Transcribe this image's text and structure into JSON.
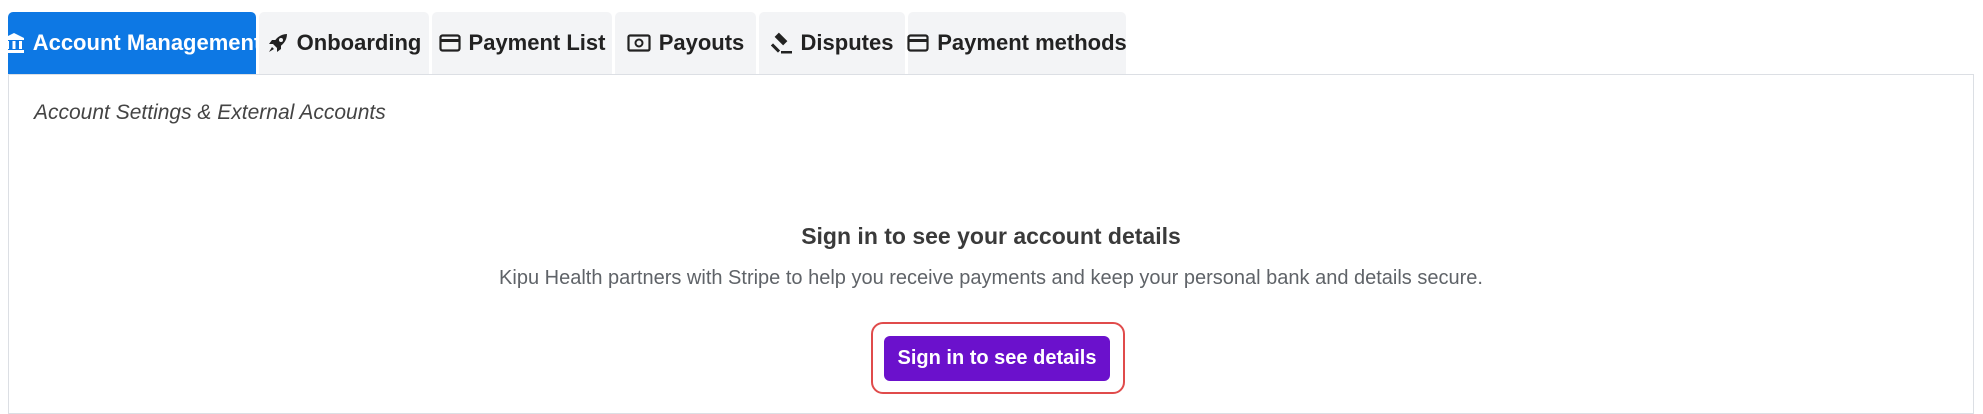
{
  "tabs": [
    {
      "label": "Account Management",
      "icon": "bank-icon",
      "active": true
    },
    {
      "label": "Onboarding",
      "icon": "rocket-icon",
      "active": false
    },
    {
      "label": "Payment List",
      "icon": "credit-card-icon",
      "active": false
    },
    {
      "label": "Payouts",
      "icon": "money-bill-icon",
      "active": false
    },
    {
      "label": "Disputes",
      "icon": "gavel-icon",
      "active": false
    },
    {
      "label": "Payment methods",
      "icon": "credit-card-icon",
      "active": false
    }
  ],
  "panel": {
    "subtitle": "Account Settings & External Accounts",
    "heading": "Sign in to see your account details",
    "description": "Kipu Health partners with Stripe to help you receive payments and keep your personal bank and details secure.",
    "button_label": "Sign in to see details"
  },
  "colors": {
    "active_tab": "#0d78e4",
    "inactive_tab": "#f3f4f6",
    "button": "#6b11cc",
    "highlight_border": "#e04b4b"
  }
}
